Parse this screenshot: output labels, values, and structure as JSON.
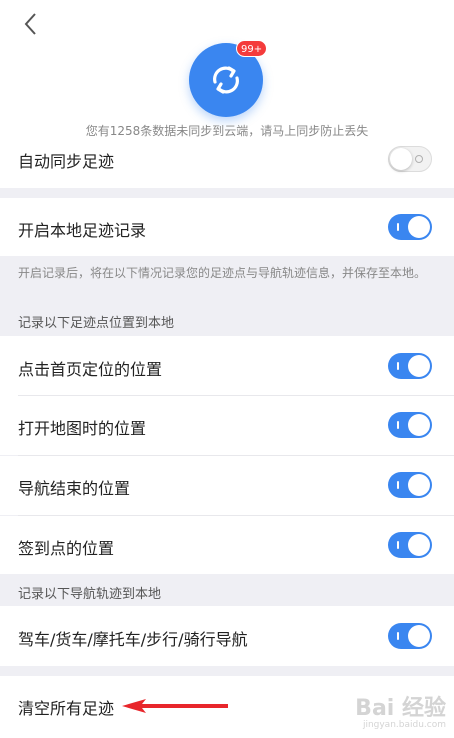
{
  "header": {
    "badge": "99+",
    "notice": "您有1258条数据未同步到云端，请马上同步防止丢失"
  },
  "settings": {
    "auto_sync": {
      "label": "自动同步足迹",
      "enabled": false
    },
    "local_record": {
      "label": "开启本地足迹记录",
      "enabled": true
    },
    "local_record_caption": "开启记录后，将在以下情况记录您的足迹点与导航轨迹信息，并保存至本地。",
    "points_section": "记录以下足迹点位置到本地",
    "points": [
      {
        "label": "点击首页定位的位置",
        "enabled": true
      },
      {
        "label": "打开地图时的位置",
        "enabled": true
      },
      {
        "label": "导航结束的位置",
        "enabled": true
      },
      {
        "label": "签到点的位置",
        "enabled": true
      }
    ],
    "tracks_section": "记录以下导航轨迹到本地",
    "tracks": [
      {
        "label": "驾车/货车/摩托车/步行/骑行导航",
        "enabled": true
      }
    ],
    "clear_all": "清空所有足迹"
  },
  "watermark": {
    "main": "Bai 经验",
    "sub": "jingyan.baidu.com"
  },
  "colors": {
    "accent": "#3a86f0",
    "badge": "#f43b3b",
    "arrow": "#e8262b"
  },
  "icons": {
    "back": "chevron-left-icon",
    "sync": "sync-icon"
  }
}
